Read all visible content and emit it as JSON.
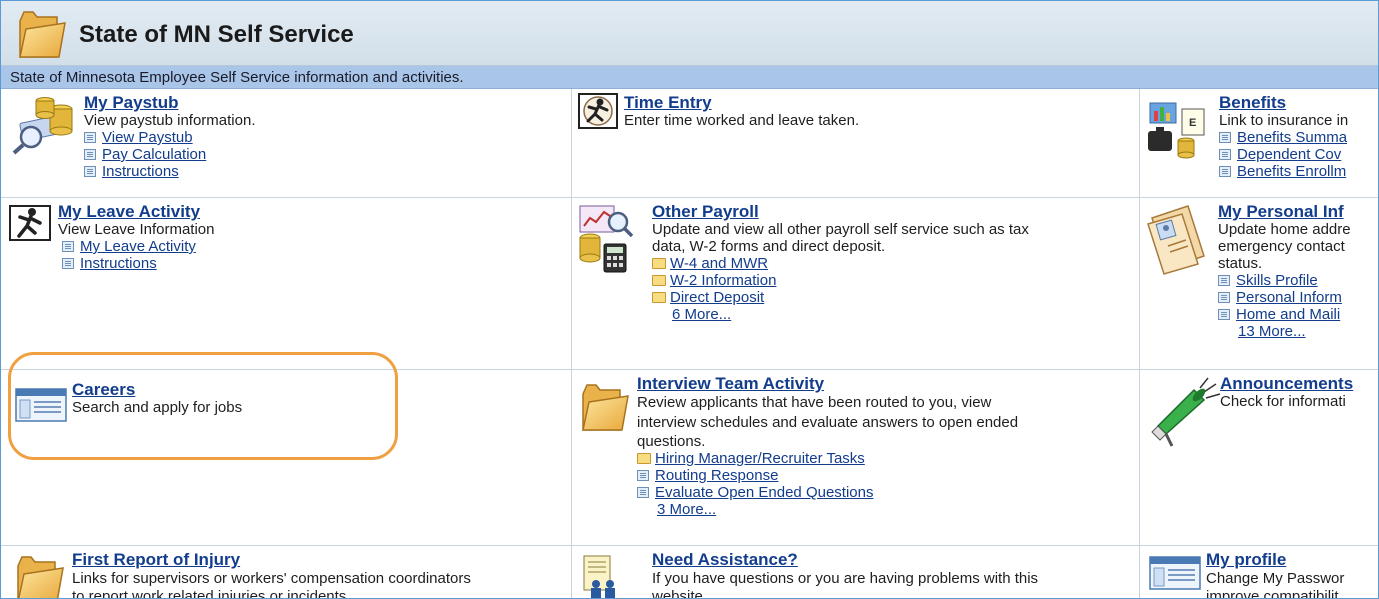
{
  "header": {
    "title": "State of MN Self Service",
    "subtitle": "State of Minnesota Employee Self Service information and activities."
  },
  "colors": {
    "link": "#123c8c",
    "highlight": "#f0a040",
    "subbar": "#a9c6e8"
  },
  "cells": {
    "paystub": {
      "title": "My Paystub",
      "desc": "View paystub information.",
      "icon": "paystub-icon",
      "links": [
        "View Paystub",
        "Pay Calculation",
        "Instructions"
      ]
    },
    "time_entry": {
      "title": "Time Entry",
      "desc": "Enter time worked and leave taken.",
      "icon": "clock-runner-icon"
    },
    "benefits": {
      "title": "Benefits",
      "desc": "Link to insurance in",
      "icon": "benefits-icon",
      "links": [
        "Benefits Summa",
        "Dependent Cov",
        "Benefits Enrollm"
      ]
    },
    "leave": {
      "title": "My Leave Activity",
      "desc": "View Leave Information",
      "icon": "running-person-icon",
      "links": [
        "My Leave Activity",
        "Instructions"
      ]
    },
    "other_payroll": {
      "title": "Other Payroll",
      "desc": [
        "Update and view all other payroll self service such as tax",
        "data, W-2 forms and direct deposit."
      ],
      "icon": "payroll-calculator-icon",
      "folders": [
        "W-4 and MWR",
        "W-2 Information",
        "Direct Deposit"
      ],
      "more": "6 More..."
    },
    "personal": {
      "title": "My Personal Inf",
      "desc": [
        "Update home addre",
        "emergency contact",
        "status."
      ],
      "icon": "personal-folder-icon",
      "links": [
        "Skills Profile",
        "Personal Inform",
        "Home and Maili"
      ],
      "more": "13 More..."
    },
    "careers": {
      "title": "Careers",
      "desc": "Search and apply for jobs",
      "icon": "browser-window-icon"
    },
    "interview": {
      "title": "Interview Team Activity",
      "desc": [
        "Review applicants that have been routed to you, view",
        "interview schedules and evaluate answers to open ended",
        "questions."
      ],
      "icon": "folder-icon",
      "folder_item": "Hiring Manager/Recruiter Tasks",
      "links": [
        "Routing Response",
        "Evaluate Open Ended Questions"
      ],
      "more": "3 More..."
    },
    "announcements": {
      "title": "Announcements",
      "desc": "Check for informati",
      "icon": "megaphone-icon"
    },
    "injury": {
      "title": "First Report of Injury",
      "desc": [
        "Links for supervisors or workers' compensation coordinators",
        "to report work related injuries or incidents."
      ],
      "icon": "folder-icon"
    },
    "assistance": {
      "title": "Need Assistance?",
      "desc": [
        "If you have questions or you are having problems with this",
        "website."
      ],
      "icon": "help-people-icon"
    },
    "profile": {
      "title": "My profile",
      "desc": [
        "Change My Passwor",
        "improve compatibilit"
      ],
      "icon": "browser-window-icon"
    }
  }
}
